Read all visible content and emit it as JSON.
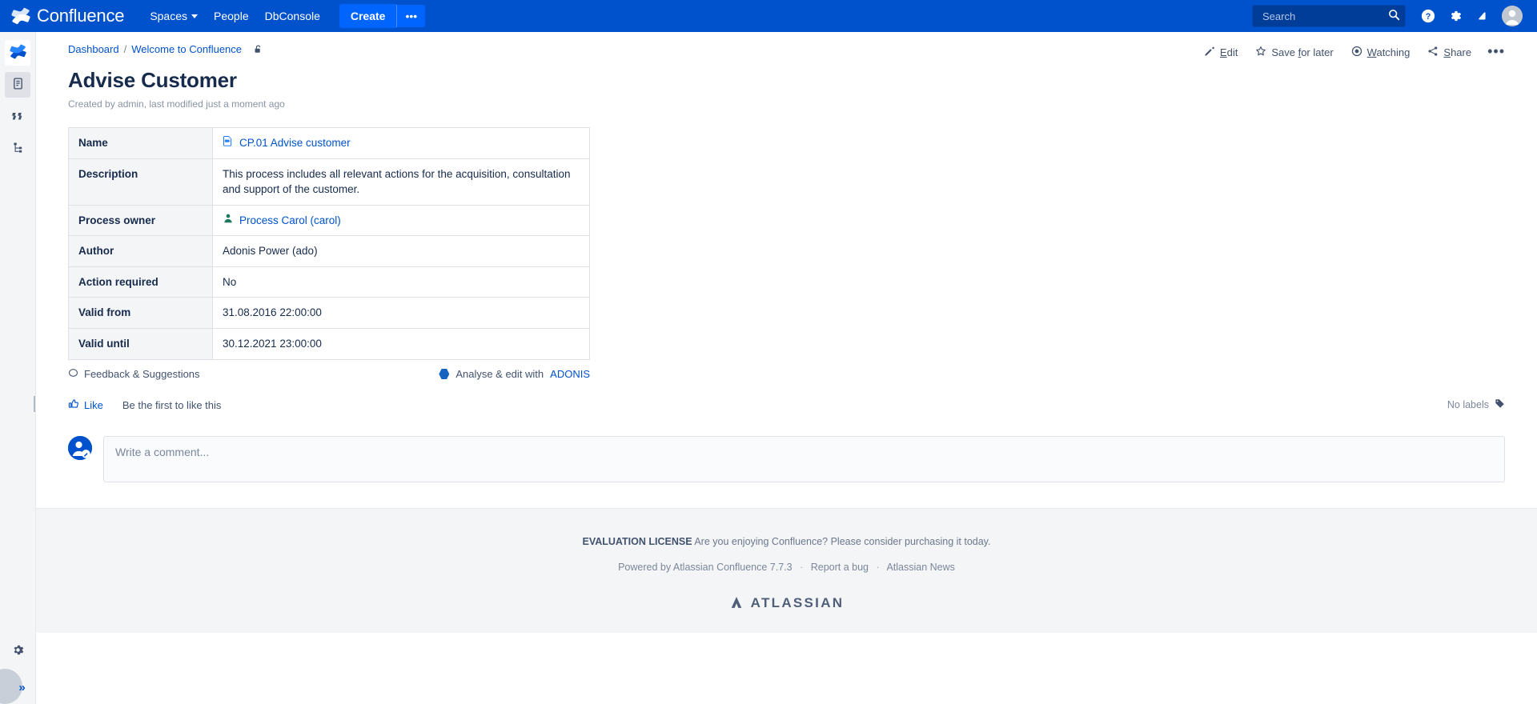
{
  "topnav": {
    "brand": "Confluence",
    "brand_logo_icon": "confluence-logo-icon",
    "items": [
      {
        "label": "Spaces",
        "has_caret": true
      },
      {
        "label": "People",
        "has_caret": false
      },
      {
        "label": "DbConsole",
        "has_caret": false
      }
    ],
    "create_label": "Create",
    "create_more_label": "•••",
    "search_placeholder": "Search",
    "search_value": "",
    "icons": [
      "help-icon",
      "settings-gear-icon",
      "notifications-bell-icon",
      "user-avatar-icon"
    ],
    "bg_color": "#0052cc",
    "create_color": "#0065ff"
  },
  "sidebar": {
    "items": [
      {
        "name": "space-logo",
        "icon": "confluence-space-logo-icon",
        "active": false
      },
      {
        "name": "pages",
        "icon": "page-list-icon",
        "active": true
      },
      {
        "name": "blog",
        "icon": "blog-quote-icon",
        "active": false
      },
      {
        "name": "page-tree",
        "icon": "page-tree-icon",
        "active": false
      }
    ],
    "settings_icon": "gear-icon",
    "expand_label": "»"
  },
  "breadcrumb": {
    "items": [
      "Dashboard",
      "Welcome to Confluence"
    ],
    "separator": "/",
    "restrictions_icon": "unlock-restrictions-icon"
  },
  "page_actions": [
    {
      "label": "Edit",
      "underline": "E",
      "icon": "pencil-icon"
    },
    {
      "label": "Save for later",
      "underline": "f",
      "icon": "star-icon"
    },
    {
      "label": "Watching",
      "underline": "W",
      "icon": "eye-watch-icon"
    },
    {
      "label": "Share",
      "underline": "S",
      "icon": "share-icon"
    }
  ],
  "page_actions_more": "•••",
  "page": {
    "title": "Advise Customer",
    "meta": "Created by admin, last modified just a moment ago"
  },
  "table": {
    "rows": [
      {
        "key": "Name",
        "value": "CP.01 Advise customer",
        "is_link": true,
        "icon": "process-page-icon"
      },
      {
        "key": "Description",
        "value": "This process includes all relevant actions for the acquisition, consultation and support of the customer.",
        "is_link": false,
        "icon": null
      },
      {
        "key": "Process owner",
        "value": "Process Carol (carol)",
        "is_link": true,
        "icon": "user-profile-icon"
      },
      {
        "key": "Author",
        "value": "Adonis Power (ado)",
        "is_link": false,
        "icon": null
      },
      {
        "key": "Action required",
        "value": "No",
        "is_link": false,
        "icon": null
      },
      {
        "key": "Valid from",
        "value": "31.08.2016 22:00:00",
        "is_link": false,
        "icon": null
      },
      {
        "key": "Valid until",
        "value": "30.12.2021 23:00:00",
        "is_link": false,
        "icon": null
      }
    ]
  },
  "below_table": {
    "feedback_label": "Feedback & Suggestions",
    "feedback_icon": "speech-bubble-icon",
    "adonis_prefix": "Analyse & edit with",
    "adonis_link": "ADONIS",
    "adonis_icon": "adonis-hexagon-icon"
  },
  "like_row": {
    "like_label": "Like",
    "like_icon": "thumbs-up-icon",
    "like_hint": "Be the first to like this",
    "labels_text": "No labels",
    "labels_icon": "label-tag-icon"
  },
  "comment": {
    "placeholder": "Write a comment...",
    "avatar_icon": "user-edit-avatar-icon"
  },
  "footer": {
    "eval_bold": "EVALUATION LICENSE",
    "eval_text": "Are you enjoying Confluence? Please consider purchasing it today.",
    "powered_by": "Powered by Atlassian Confluence 7.7.3",
    "report_bug": "Report a bug",
    "atlassian_news": "Atlassian News",
    "separator": "·",
    "brand": "ATLASSIAN",
    "brand_icon": "atlassian-mark-icon"
  }
}
